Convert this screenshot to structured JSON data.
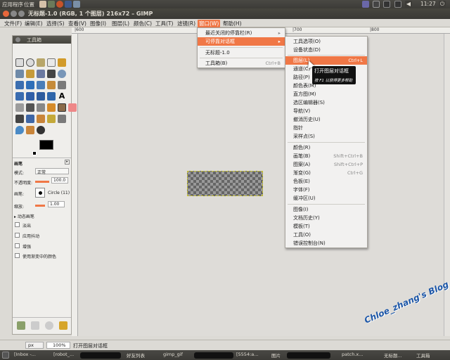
{
  "top_panel": {
    "apps": "应用程序",
    "places": "位置",
    "clock": "11:27"
  },
  "window": {
    "title": "无标题-1.0 (RGB, 1 个图层) 216x72 – GIMP"
  },
  "menubar": [
    "文件(F)",
    "编辑(E)",
    "选择(S)",
    "查看(V)",
    "图像(I)",
    "图层(L)",
    "颜色(C)",
    "工具(T)",
    "滤镜(R)",
    "窗口(W)",
    "帮助(H)"
  ],
  "ruler": {
    "label_a": "|600",
    "label_b": "|700",
    "label_c": "|800"
  },
  "toolbox": {
    "title": "工具箱",
    "options_title": "画笔",
    "mode_label": "模式:",
    "mode_value": "正常",
    "opacity_label": "不透明度:",
    "opacity_value": "100.0",
    "brush_label": "画笔:",
    "brush_value": "Circle (11)",
    "scale_label": "缩放:",
    "scale_value": "1.00",
    "dynamics": "动态画笔",
    "checks": [
      "淡出",
      "应用抖动",
      "增强",
      "使用渐变中的颜色"
    ]
  },
  "window_menu": {
    "items": [
      {
        "label": "最近关闭的停靠栏(R)",
        "arrow": "▸"
      },
      {
        "label": "可停靠对话框",
        "arrow": "▸"
      },
      {
        "label": "无标题-1.0"
      },
      {
        "label": "工具箱(B)",
        "shortcut": "Ctrl+B"
      }
    ]
  },
  "dockable_menu": {
    "items": [
      {
        "label": "工具选项(O)"
      },
      {
        "label": "设备状态(D)"
      },
      {
        "label": "图层(L)",
        "shortcut": "Ctrl+L"
      },
      {
        "label": "通道(C)"
      },
      {
        "label": "路径(P)"
      },
      {
        "label": "颜色表(M)"
      },
      {
        "label": "直方图(M)"
      },
      {
        "label": "选区编辑器(S)"
      },
      {
        "label": "导航(V)"
      },
      {
        "label": "撤消历史(U)"
      },
      {
        "label": "指针"
      },
      {
        "label": "采样点(S)"
      },
      {
        "label": "颜色(R)"
      },
      {
        "label": "画笔(B)",
        "shortcut": "Shift+Ctrl+B"
      },
      {
        "label": "图案(A)",
        "shortcut": "Shift+Ctrl+P"
      },
      {
        "label": "渐变(G)",
        "shortcut": "Ctrl+G"
      },
      {
        "label": "色板(E)"
      },
      {
        "label": "字体(F)"
      },
      {
        "label": "缓冲区(U)"
      },
      {
        "label": "图像(I)"
      },
      {
        "label": "文档历史(Y)"
      },
      {
        "label": "模板(T)"
      },
      {
        "label": "工具(O)"
      },
      {
        "label": "错误控制台(N)"
      }
    ]
  },
  "tooltip": {
    "title": "打开图层对话框",
    "hint": "按 F1 以获得更多帮助"
  },
  "statusbar": {
    "unit": "px",
    "zoom": "100%",
    "message": "打开图层对话框"
  },
  "taskbar": [
    "[Inbox -...",
    "[robot_...",
    "好友列表",
    "gimp_gif",
    "[5554:a...",
    "图片",
    "patch.x...",
    "无标题...",
    "工具箱"
  ],
  "watermark": "Chloe_zhang's Blog"
}
